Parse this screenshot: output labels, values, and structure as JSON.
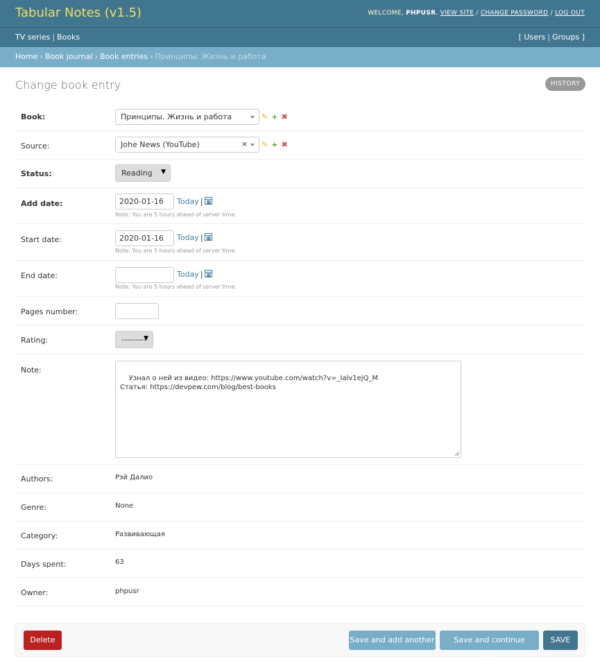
{
  "header": {
    "app_title": "Tabular Notes (v1.5)",
    "welcome": "WELCOME,",
    "username": "PHPUSR",
    "view_site": "VIEW SITE",
    "change_password": "CHANGE PASSWORD",
    "log_out": "LOG OUT",
    "sep": "/"
  },
  "navbar": {
    "left": [
      "TV series",
      "Books"
    ],
    "right_open": "[",
    "right": [
      "Users",
      "Groups"
    ],
    "right_close": "]",
    "sep": "|"
  },
  "breadcrumbs": {
    "items": [
      "Home",
      "Book journal",
      "Book entries"
    ],
    "current": "Принципы. Жизнь и работа",
    "sep": "›"
  },
  "page": {
    "title": "Change book entry",
    "history_label": "HISTORY"
  },
  "form": {
    "book": {
      "label": "Book:",
      "value": "Принципы. Жизнь и работа"
    },
    "source": {
      "label": "Source:",
      "value": "Johe News (YouTube)",
      "clear": "×"
    },
    "status": {
      "label": "Status:",
      "value": "Reading",
      "caret": "▼"
    },
    "add_date": {
      "label": "Add date:",
      "value": "2020-01-16"
    },
    "start_date": {
      "label": "Start date:",
      "value": "2020-01-16"
    },
    "end_date": {
      "label": "End date:",
      "value": ""
    },
    "today_label": "Today",
    "today_sep": "|",
    "tz_note": "Note: You are 5 hours ahead of server time.",
    "pages_number": {
      "label": "Pages number:",
      "value": ""
    },
    "rating": {
      "label": "Rating:",
      "value": "---------",
      "caret": "▼"
    },
    "note": {
      "label": "Note:",
      "value": "Узнал о ней из видео: https://www.youtube.com/watch?v=_Ialv1ejQ_M\nСтатья: https://devpew.com/blog/best-books"
    },
    "authors": {
      "label": "Authors:",
      "value": "Рэй Далио"
    },
    "genre": {
      "label": "Genre:",
      "value": "None"
    },
    "category": {
      "label": "Category:",
      "value": "Развивающая"
    },
    "days_spent": {
      "label": "Days spent:",
      "value": "63"
    },
    "owner": {
      "label": "Owner:",
      "value": "phpusr"
    }
  },
  "icons": {
    "edit": "✎",
    "add": "+",
    "delete": "✖"
  },
  "buttons": {
    "delete": "Delete",
    "save_add_another": "Save and add another",
    "save_continue": "Save and continue editing",
    "save": "SAVE"
  },
  "colors": {
    "header_bg": "#417690",
    "breadcrumb_bg": "#79aec8",
    "title_yellow": "#f5dd5d",
    "delete_red": "#ba2121",
    "link": "#447e9b"
  }
}
